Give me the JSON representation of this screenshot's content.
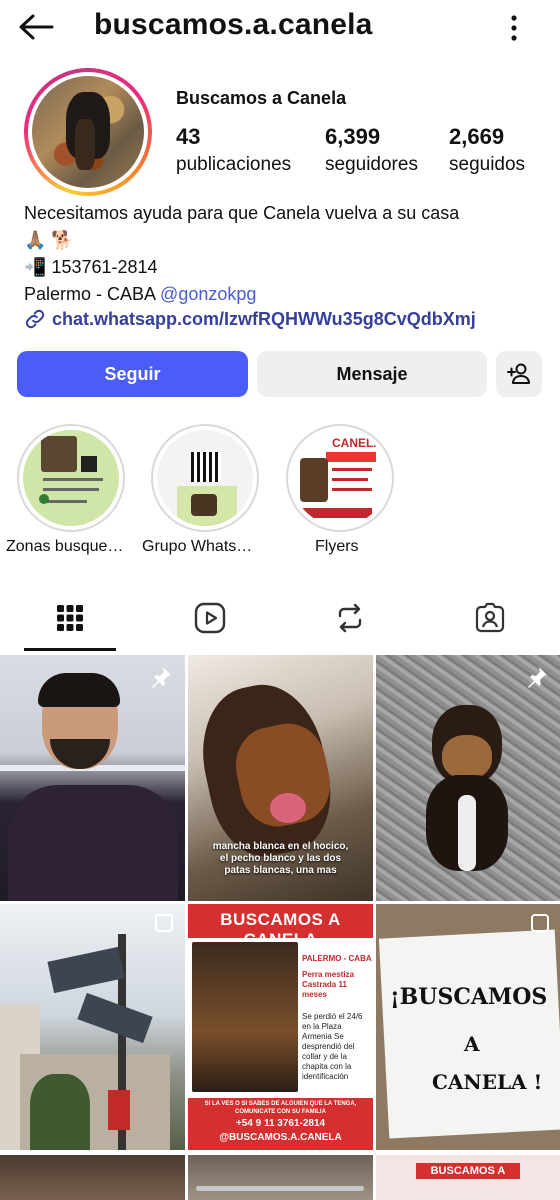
{
  "header": {
    "username": "buscamos.a.canela"
  },
  "profile": {
    "display_name": "Buscamos a Canela",
    "stats": [
      {
        "value": "43",
        "label": "publicaciones"
      },
      {
        "value": "6,399",
        "label": "seguidores"
      },
      {
        "value": "2,669",
        "label": "seguidos"
      }
    ],
    "bio": {
      "line1": "Necesitamos ayuda para que Canela vuelva a su casa",
      "line2": "🙏🏽 🐕",
      "line3_icon": "📲",
      "line3": "153761-2814",
      "line4_text": "Palermo - CABA ",
      "line4_mention": "@gonzokpg",
      "link": "chat.whatsapp.com/IzwfRQHWWu35g8CvQdbXmj"
    }
  },
  "actions": {
    "follow": "Seguir",
    "message": "Mensaje"
  },
  "highlights": [
    {
      "label": "Zonas busque…"
    },
    {
      "label": "Grupo Whats…"
    },
    {
      "label": "Flyers"
    }
  ],
  "tabs": [
    "grid-icon",
    "reels-icon",
    "reposts-icon",
    "tagged-icon"
  ],
  "posts": {
    "p2_caption": "mancha blanca en el hocico, el pecho blanco y las dos patas blancas, una mas",
    "p5": {
      "title": "BUSCAMOS A CANELA",
      "side1": "PALERMO - CABA",
      "side2": "Perra mestiza Castrada 11 meses",
      "side3": "Se perdió el 24/6 en la Plaza Armenia Se desprendió del collar y de la chapita con la identificación",
      "bottom1": "SI LA VES O SI SABES DE ALGUIEN QUE LA TENGA, COMUNICATE CON SU FAMILIA",
      "bottom2": "+54 9 11 3761-2814",
      "bottom3": "@BUSCAMOS.A.CANELA"
    },
    "p6": {
      "w1": "¡BUSCAMOS",
      "w2": "A",
      "w3": "CANELA !"
    },
    "peek_title": "BUSCAMOS A"
  },
  "colors": {
    "follow": "#4a5df9",
    "link": "#36409a",
    "mention": "#4a5bd6"
  }
}
